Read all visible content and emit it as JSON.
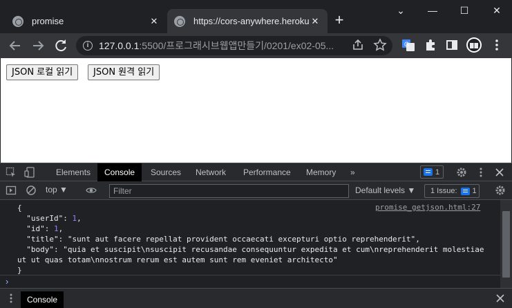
{
  "browser": {
    "tabs": [
      {
        "title": "promise",
        "close": "✕"
      },
      {
        "title": "https://cors-anywhere.herokua",
        "close": "✕"
      }
    ],
    "new_tab": "+",
    "window_controls": {
      "chevron": "⌄",
      "minimize": "—",
      "maximize": "☐",
      "close": "✕"
    },
    "address": {
      "host": "127.0.0.1",
      "path": ":5500/프로그래시브웹앱만들기/0201/ex02-05..."
    }
  },
  "page": {
    "buttons": [
      {
        "label": "JSON 로컬 읽기"
      },
      {
        "label": "JSON 원격 읽기"
      }
    ]
  },
  "devtools": {
    "tabs": [
      "Elements",
      "Console",
      "Sources",
      "Network",
      "Performance",
      "Memory"
    ],
    "more": "»",
    "issues_badge": "1",
    "context": "top",
    "filter_placeholder": "Filter",
    "levels": "Default levels",
    "issues_button": "1 Issue:",
    "issues_count": "1",
    "source_link": "promise_getjson.html:27",
    "output": {
      "open": "{",
      "userId_key": "\"userId\"",
      "userId_val": "1",
      "id_key": "\"id\"",
      "id_val": "1",
      "title_key": "\"title\"",
      "title_val": "\"sunt aut facere repellat provident occaecati excepturi optio reprehenderit\"",
      "body_key": "\"body\"",
      "body_val_1": "\"quia et suscipit\\nsuscipit recusandae consequuntur expedita et cum\\nreprehenderit molestiae",
      "body_val_2": "ut ut quas totam\\nnostrum rerum est autem sunt rem eveniet architecto\"",
      "close": "}"
    },
    "prompt_symbol": "›",
    "drawer_tab": "Console"
  },
  "colors": {
    "console_string": "#f28b82",
    "console_number": "#9980ff",
    "accent_blue": "#1a73e8"
  }
}
